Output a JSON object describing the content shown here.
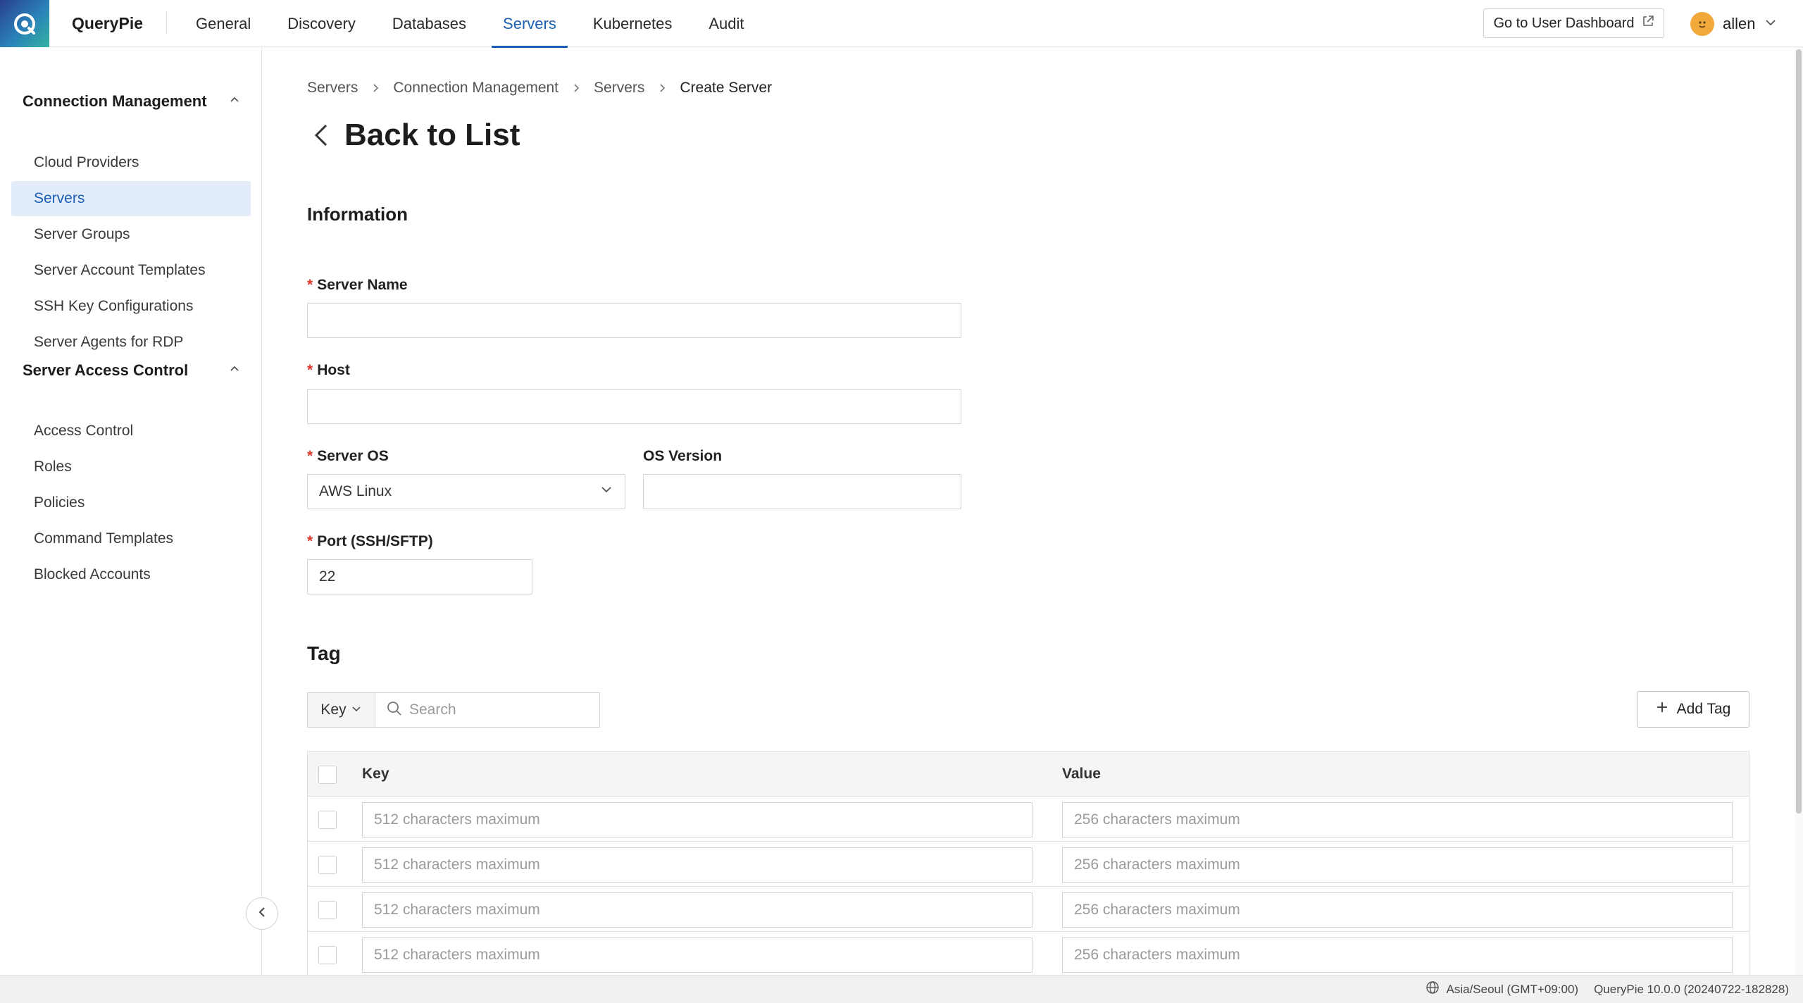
{
  "brand": {
    "name": "QueryPie",
    "logo_icon": "querypie-logo-icon"
  },
  "nav": {
    "items": [
      {
        "label": "General",
        "active": false
      },
      {
        "label": "Discovery",
        "active": false
      },
      {
        "label": "Databases",
        "active": false
      },
      {
        "label": "Servers",
        "active": true
      },
      {
        "label": "Kubernetes",
        "active": false
      },
      {
        "label": "Audit",
        "active": false
      }
    ],
    "accent": "#1c5fb6"
  },
  "header": {
    "dashboard_button": "Go to User Dashboard",
    "dashboard_icon": "external-link-icon",
    "user_name": "allen",
    "user_icon": "chevron-down-icon"
  },
  "sidebar": {
    "groups": [
      {
        "title": "Connection Management",
        "items": [
          {
            "label": "Cloud Providers",
            "active": false
          },
          {
            "label": "Servers",
            "active": true
          },
          {
            "label": "Server Groups",
            "active": false
          },
          {
            "label": "Server Account Templates",
            "active": false
          },
          {
            "label": "SSH Key Configurations",
            "active": false
          },
          {
            "label": "Server Agents for RDP",
            "active": false
          }
        ]
      },
      {
        "title": "Server Access Control",
        "items": [
          {
            "label": "Access Control",
            "active": false
          },
          {
            "label": "Roles",
            "active": false
          },
          {
            "label": "Policies",
            "active": false
          },
          {
            "label": "Command Templates",
            "active": false
          },
          {
            "label": "Blocked Accounts",
            "active": false
          }
        ]
      }
    ]
  },
  "breadcrumb": [
    "Servers",
    "Connection Management",
    "Servers",
    "Create Server"
  ],
  "page": {
    "title": "Back to List"
  },
  "information": {
    "section_title": "Information",
    "server_name": {
      "label": "Server Name",
      "value": ""
    },
    "host": {
      "label": "Host",
      "value": ""
    },
    "server_os": {
      "label": "Server OS",
      "value": "AWS Linux"
    },
    "os_version": {
      "label": "OS Version",
      "value": ""
    },
    "port": {
      "label": "Port (SSH/SFTP)",
      "value": "22"
    }
  },
  "tag": {
    "section_title": "Tag",
    "filter_key": "Key",
    "search_placeholder": "Search",
    "add_button": "Add Tag",
    "columns": {
      "key": "Key",
      "value": "Value"
    },
    "key_placeholder": "512 characters maximum",
    "value_placeholder": "256 characters maximum",
    "rows": [
      {
        "key": "",
        "value": ""
      },
      {
        "key": "",
        "value": ""
      },
      {
        "key": "",
        "value": ""
      },
      {
        "key": "",
        "value": ""
      }
    ]
  },
  "footer": {
    "timezone": "Asia/Seoul (GMT+09:00)",
    "version": "QueryPie 10.0.0 (20240722-182828)"
  }
}
